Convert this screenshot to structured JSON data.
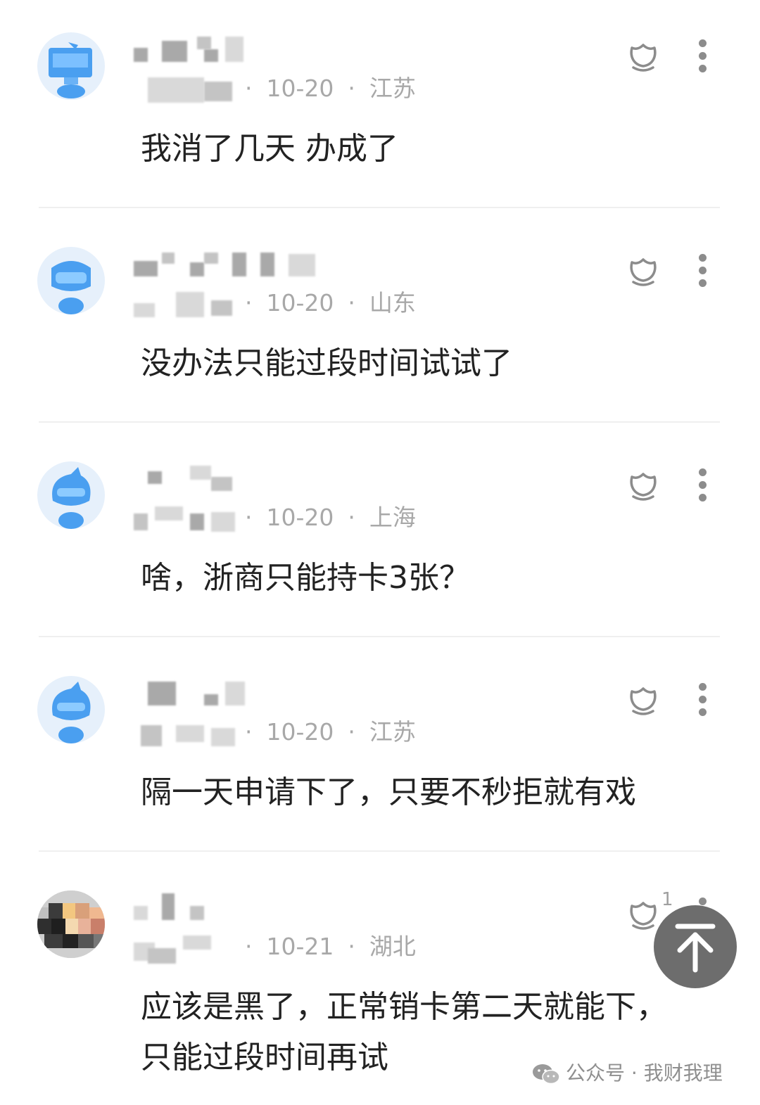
{
  "comments": [
    {
      "date": "10-20",
      "location": "江苏",
      "text": "我消了几天 办成了",
      "avatar": "blue-monitor-avatar"
    },
    {
      "date": "10-20",
      "location": "山东",
      "text": "没办法只能过段时间试试了",
      "avatar": "blue-ghost-avatar"
    },
    {
      "date": "10-20",
      "location": "上海",
      "text": "啥，浙商只能持卡3张？",
      "avatar": "blue-character-avatar"
    },
    {
      "date": "10-20",
      "location": "江苏",
      "text": "隔一天申请下了，只要不秒拒就有戏",
      "avatar": "blue-character-avatar"
    },
    {
      "date": "10-21",
      "location": "湖北",
      "text_line1": "应该是黑了，正常销卡第二天就能下，",
      "text_line2": "只能过段时间再试",
      "like_count": "1",
      "avatar": "pixelated-photo-avatar"
    }
  ],
  "separator": "·",
  "watermark": {
    "label": "公众号 · 我财我理",
    "icon": "wechat-icon"
  },
  "scroll_top": {
    "icon": "arrow-up-icon"
  },
  "colors": {
    "meta_text": "#a8a8a8",
    "body_text": "#222222",
    "avatar_blue": "#4a9ff0",
    "button_bg": "#6d6d6d"
  }
}
